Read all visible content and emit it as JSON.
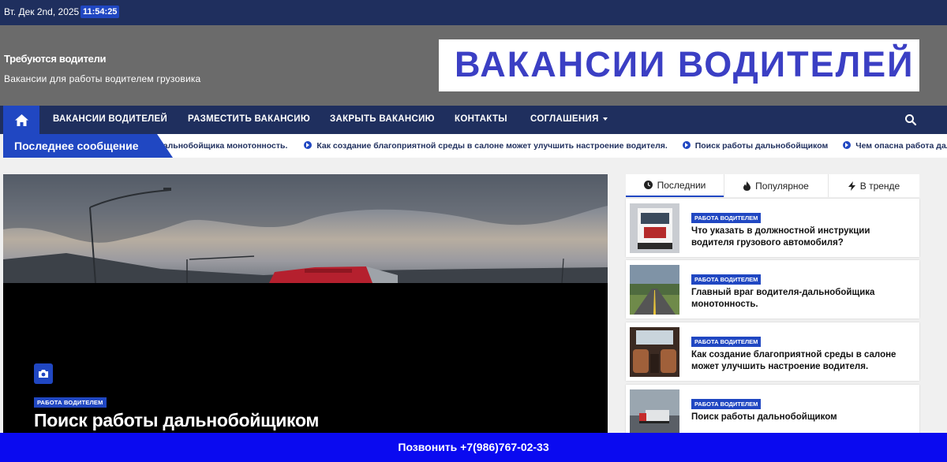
{
  "topbar": {
    "date": "Вт. Дек 2nd, 2025",
    "time": "11:54:25"
  },
  "header": {
    "site_title": "Требуются водители",
    "site_description": "Вакансии для работы водителем грузовика",
    "banner_text": "ВАКАНСИИ ВОДИТЕЛЕЙ"
  },
  "nav": {
    "home_icon": "home-icon",
    "items": [
      {
        "label": "ВАКАНСИИ ВОДИТЕЛЕЙ"
      },
      {
        "label": "РАЗМЕСТИТЬ ВАКАНСИЮ"
      },
      {
        "label": "ЗАКРЫТЬ ВАКАНСИЮ"
      },
      {
        "label": "КОНТАКТЫ"
      },
      {
        "label": "СОГЛАШЕНИЯ"
      }
    ],
    "search_icon": "search-icon"
  },
  "ticker": {
    "label": "Последнее сообщение",
    "items": [
      "Главный враг водителя-дальнобойщика монотонность.",
      "Как создание благоприятной среды в салоне может улучшить настроение водителя.",
      "Поиск работы дальнобойщиком",
      "Чем опасна работа дальнобойщика"
    ]
  },
  "featured": {
    "category": "РАБОТА ВОДИТЕЛЕМ",
    "title": "Поиск работы дальнобойщиком",
    "icon": "camera-icon"
  },
  "sidebar": {
    "tabs": [
      {
        "label": "Последнии",
        "icon": "clock-icon"
      },
      {
        "label": "Популярное",
        "icon": "fire-icon"
      },
      {
        "label": "В тренде",
        "icon": "bolt-icon"
      }
    ],
    "posts": [
      {
        "category": "РАБОТА ВОДИТЕЛЕМ",
        "title": "Что указать в должностной инструкции водителя грузового автомобиля?"
      },
      {
        "category": "РАБОТА ВОДИТЕЛЕМ",
        "title": "Главный враг водителя-дальнобойщика монотонность."
      },
      {
        "category": "РАБОТА ВОДИТЕЛЕМ",
        "title": "Как создание благоприятной среды в салоне может улучшить настроение водителя."
      },
      {
        "category": "РАБОТА ВОДИТЕЛЕМ",
        "title": "Поиск работы дальнобойщиком"
      }
    ]
  },
  "callbar": {
    "text": "Позвонить +7(986)767-02-33"
  },
  "colors": {
    "navy": "#1f2f5e",
    "accent_blue": "#2047c2",
    "header_gray": "#6b6b6b",
    "call_blue": "#0a0af0",
    "banner_text": "#3b3fc4"
  }
}
